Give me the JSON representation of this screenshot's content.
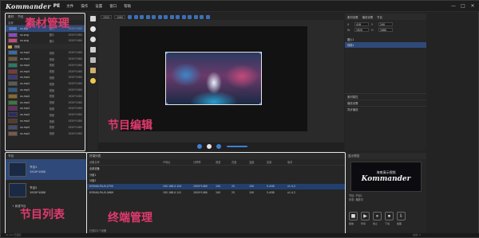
{
  "app": {
    "logo": "Kommander",
    "suffix": "PE"
  },
  "menu": [
    "文件",
    "操作",
    "设置",
    "窗口",
    "帮助"
  ],
  "window_controls": [
    "—",
    "□",
    "✕"
  ],
  "materials": {
    "tabs": [
      "素材",
      "节目"
    ],
    "header": {
      "name": "名称",
      "type": "类型",
      "res": "分辨率"
    },
    "items": [
      {
        "name": "xx.jpg",
        "type": "图片",
        "res": "1920*1080",
        "color": "#4a78c4"
      },
      {
        "name": "xx.png",
        "type": "图片",
        "res": "1920*1080",
        "color": "#8a4ac4"
      },
      {
        "name": "xx.png",
        "type": "图片",
        "res": "1920*1080",
        "color": "#c44a7a"
      }
    ],
    "folder": "视频",
    "videos": [
      {
        "name": "xx.mp4",
        "type": "视频",
        "res": "1920*1080",
        "color": "#3a6aa8"
      },
      {
        "name": "xx.mp4",
        "type": "视频",
        "res": "1920*1080",
        "color": "#6a5a3a"
      },
      {
        "name": "xx.mp4",
        "type": "视频",
        "res": "1920*1080",
        "color": "#2a7a6a"
      },
      {
        "name": "xx.mp4",
        "type": "视频",
        "res": "1920*1080",
        "color": "#7a3a3a"
      },
      {
        "name": "xx.mp4",
        "type": "视频",
        "res": "1920*1080",
        "color": "#3a3a7a"
      },
      {
        "name": "xx.mp4",
        "type": "视频",
        "res": "1920*1080",
        "color": "#5a5a5a"
      },
      {
        "name": "xx.mp4",
        "type": "视频",
        "res": "1920*1080",
        "color": "#2a5a8a"
      },
      {
        "name": "xx.mp4",
        "type": "视频",
        "res": "1920*1080",
        "color": "#8a6a2a"
      },
      {
        "name": "xx.mp4",
        "type": "视频",
        "res": "1920*1080",
        "color": "#3a7a3a"
      },
      {
        "name": "xx.mp4",
        "type": "视频",
        "res": "1920*1080",
        "color": "#6a2a6a"
      },
      {
        "name": "xx.mp4",
        "type": "视频",
        "res": "1920*1080",
        "color": "#2a2a6a"
      },
      {
        "name": "xx.mp4",
        "type": "视频",
        "res": "1920*1080",
        "color": "#5a3a2a"
      },
      {
        "name": "xx.mp4",
        "type": "视频",
        "res": "1920*1080",
        "color": "#4a4a6a"
      },
      {
        "name": "xx.mp4",
        "type": "视频",
        "res": "1920*1080",
        "color": "#7a5a4a"
      }
    ],
    "overlay_label": "素材管理"
  },
  "editor": {
    "resolution": "1920",
    "height": "1080",
    "overlay_label": "节目编辑"
  },
  "properties": {
    "tabs": [
      "素材设置",
      "播放设置",
      "节目"
    ],
    "fields": [
      {
        "k": "X",
        "v": "418"
      },
      {
        "k": "Y",
        "v": "240"
      },
      {
        "k": "W",
        "v": "1920"
      },
      {
        "k": "H",
        "v": "1080"
      }
    ],
    "layers": [
      {
        "name": "图片1",
        "sel": false
      },
      {
        "name": "视频1",
        "sel": true
      }
    ],
    "sections": [
      "素材属性",
      "播放设置",
      "同步播放"
    ]
  },
  "programs": {
    "header": "节目",
    "items": [
      {
        "name": "节目1",
        "res": "1920*1080",
        "sel": true
      },
      {
        "name": "节目2",
        "res": "1920*1080",
        "sel": false
      }
    ],
    "add": "+ 新建节目",
    "overlay_label": "节目列表"
  },
  "terminals": {
    "header": "终端列表",
    "columns": [
      "设备名称",
      "IP地址",
      "分辨率",
      "音量",
      "亮度",
      "温度",
      "容量",
      "版本"
    ],
    "groups": [
      "全部设备",
      "分组1",
      "分组2"
    ],
    "rows": [
      {
        "name": "KYONIX-PLUS-0750",
        "ip": "192.168.0.104",
        "res": "1920*1080",
        "vol": "100",
        "bright": "25",
        "temp": "100",
        "cap": "5.4GB",
        "ver": "v1.4.2",
        "sel": true
      },
      {
        "name": "KYONIX-PLUS-0669",
        "ip": "192.168.0.141",
        "res": "1920*1080",
        "vol": "100",
        "bright": "25",
        "temp": "100",
        "cap": "5.4GB",
        "ver": "v1.4.2",
        "sel": false
      }
    ],
    "footer": "已选中1个设备",
    "overlay_label": "终端管理"
  },
  "preview": {
    "header": "显示预览",
    "screen_title": "海南演示视频",
    "screen_logo": "Kommander",
    "info": [
      "节目: 节目1",
      "状态: 播放中"
    ],
    "buttons": [
      "■",
      "▶",
      "⏸",
      "⏹",
      "⇩"
    ],
    "button_labels": [
      "播放",
      "暂停",
      "停止",
      "下载",
      "截图"
    ]
  },
  "status": {
    "left": "v1.0.0 已连接",
    "right": "在线: 2"
  }
}
